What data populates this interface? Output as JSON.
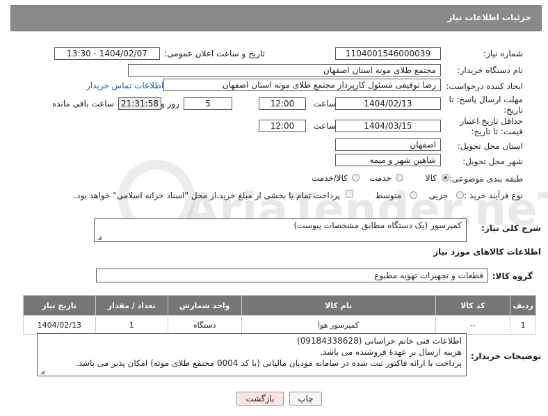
{
  "header": {
    "title": "جزئیات اطلاعات نیاز"
  },
  "form": {
    "need_number_label": "شماره نیاز:",
    "need_number": "1104001546000039",
    "announce_label": "تاریخ و ساعت اعلان عمومی:",
    "announce_value": "1404/02/07 - 13:30",
    "buyer_label": "نام دستگاه خریدار:",
    "buyer_value": "مجتمع طلای موته استان اصفهان",
    "creator_label": "ایجاد کننده درخواست:",
    "creator_value": "رضا توفیقی مسئول کارپرداز مجتمع طلای موته استان اصفهان",
    "contact_link": "اطلاعات تماس خریدار",
    "reply_deadline_label": "مهلت ارسال پاسخ: تا تاریخ:",
    "reply_date": "1404/02/13",
    "time_label": "ساعت",
    "reply_time": "12:00",
    "days_value": "5",
    "days_label": "روز و",
    "remaining_time": "21:31:58",
    "remaining_label": "ساعت باقی مانده",
    "price_deadline_label": "حداقل تاریخ اعتبار قیمت: تا تاریخ:",
    "price_date": "1404/03/15",
    "price_time": "12:00",
    "province_label": "استان محل تحویل:",
    "province_value": "اصفهان",
    "city_label": "شهر محل تحویل:",
    "city_value": "شاهین شهر و میمه",
    "category_label": "طبقه بندی موضوعی:",
    "category_options": [
      "کالا",
      "خدمت",
      "کالا/خدمت"
    ],
    "process_label": "نوع فرآیند خرید :",
    "process_options": [
      "جزیی",
      "متوسط"
    ],
    "payment_note": "پرداخت تمام یا بخشی از مبلغ خرید،از محل \"اسناد خزانه اسلامی\" خواهد بود."
  },
  "description": {
    "label": "شرح کلی نیاز:",
    "value": "کمپرسور (یک دستگاه مطابق مشخصات پیوست)"
  },
  "goods_section": {
    "title": "اطلاعات کالاهای مورد نیاز",
    "group_label": "گروه کالا:",
    "group_value": "قطعات و تجهیزات تهویه مطبوع"
  },
  "table": {
    "headers": [
      "ردیف",
      "کد کالا",
      "نام کالا",
      "واحد شمارش",
      "تعداد / مقدار",
      "تاریخ نیاز"
    ],
    "rows": [
      [
        "1",
        "--",
        "کمپرسور هوا",
        "دستگاه",
        "1",
        "1404/02/13"
      ]
    ]
  },
  "buyer_notes": {
    "label": "توضیحات خریدار:",
    "lines": [
      "اطلاعات فنی خانم خراسانی (09184338628)",
      "هزینه ارسال بر عهدهٔ فروشنده می باشد.",
      "پرداخت با ارائه فاکتور ثبت شده در سامانه مودیان مالیاتی (با کد 0004 مجتمع طلای موته) امکان پذیر می باشد."
    ]
  },
  "buttons": {
    "print": "چاپ",
    "back": "بازگشت"
  },
  "watermark": {
    "text": "AriaTender.neT"
  },
  "colors": {
    "header_bg": "#8a8a8a",
    "table_header_bg": "#777777",
    "link": "#1a5fb4",
    "back_button_bg": "#fbe3e3"
  }
}
